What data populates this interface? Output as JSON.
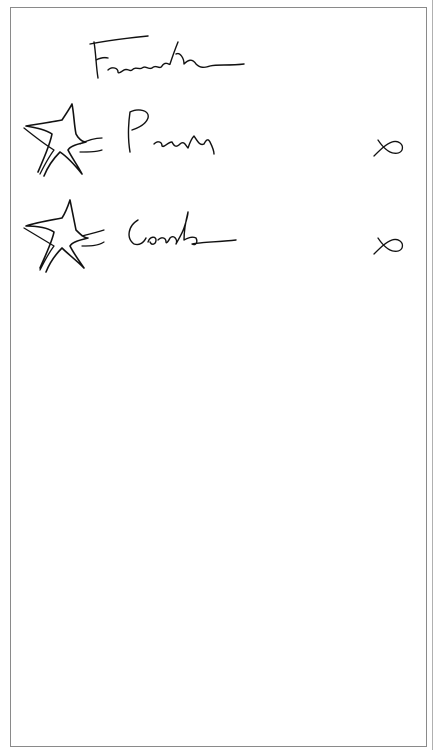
{
  "screen": {
    "title": "Favourites",
    "title_style": "handwritten"
  },
  "favorites": [
    {
      "label": "Paris",
      "icon": "star-icon",
      "action_icon": "remove-icon"
    },
    {
      "label": "London",
      "icon": "star-icon",
      "action_icon": "remove-icon"
    }
  ],
  "colors": {
    "background": "#ffffff",
    "ink": "#111111",
    "frame": "#8a8a8a"
  }
}
